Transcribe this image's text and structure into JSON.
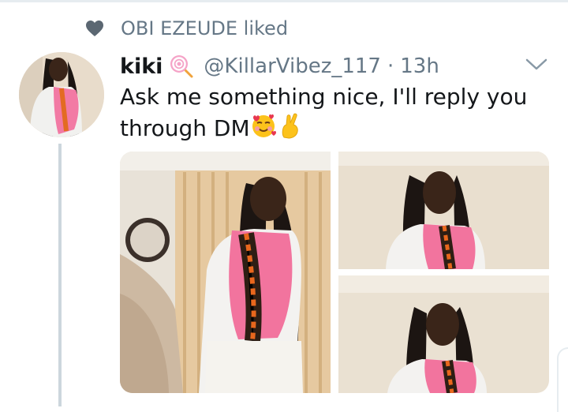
{
  "social_context": {
    "text": "OBI EZEUDE liked",
    "icon": "heart-icon"
  },
  "tweet": {
    "display_name": "kiki",
    "name_emoji": "lollipop-icon",
    "handle": "@KillarVibez_117",
    "separator": "·",
    "time": "13h",
    "text_line1": "Ask me something nice, I'll reply you",
    "text_line2": "through DM",
    "text_emojis": [
      "smiling-face-with-hearts-icon",
      "crossed-fingers-icon"
    ],
    "media_count": 3
  },
  "colors": {
    "muted": "#657786",
    "text": "#14171a",
    "line": "#ccd6dd",
    "pink": "#f0669b"
  }
}
